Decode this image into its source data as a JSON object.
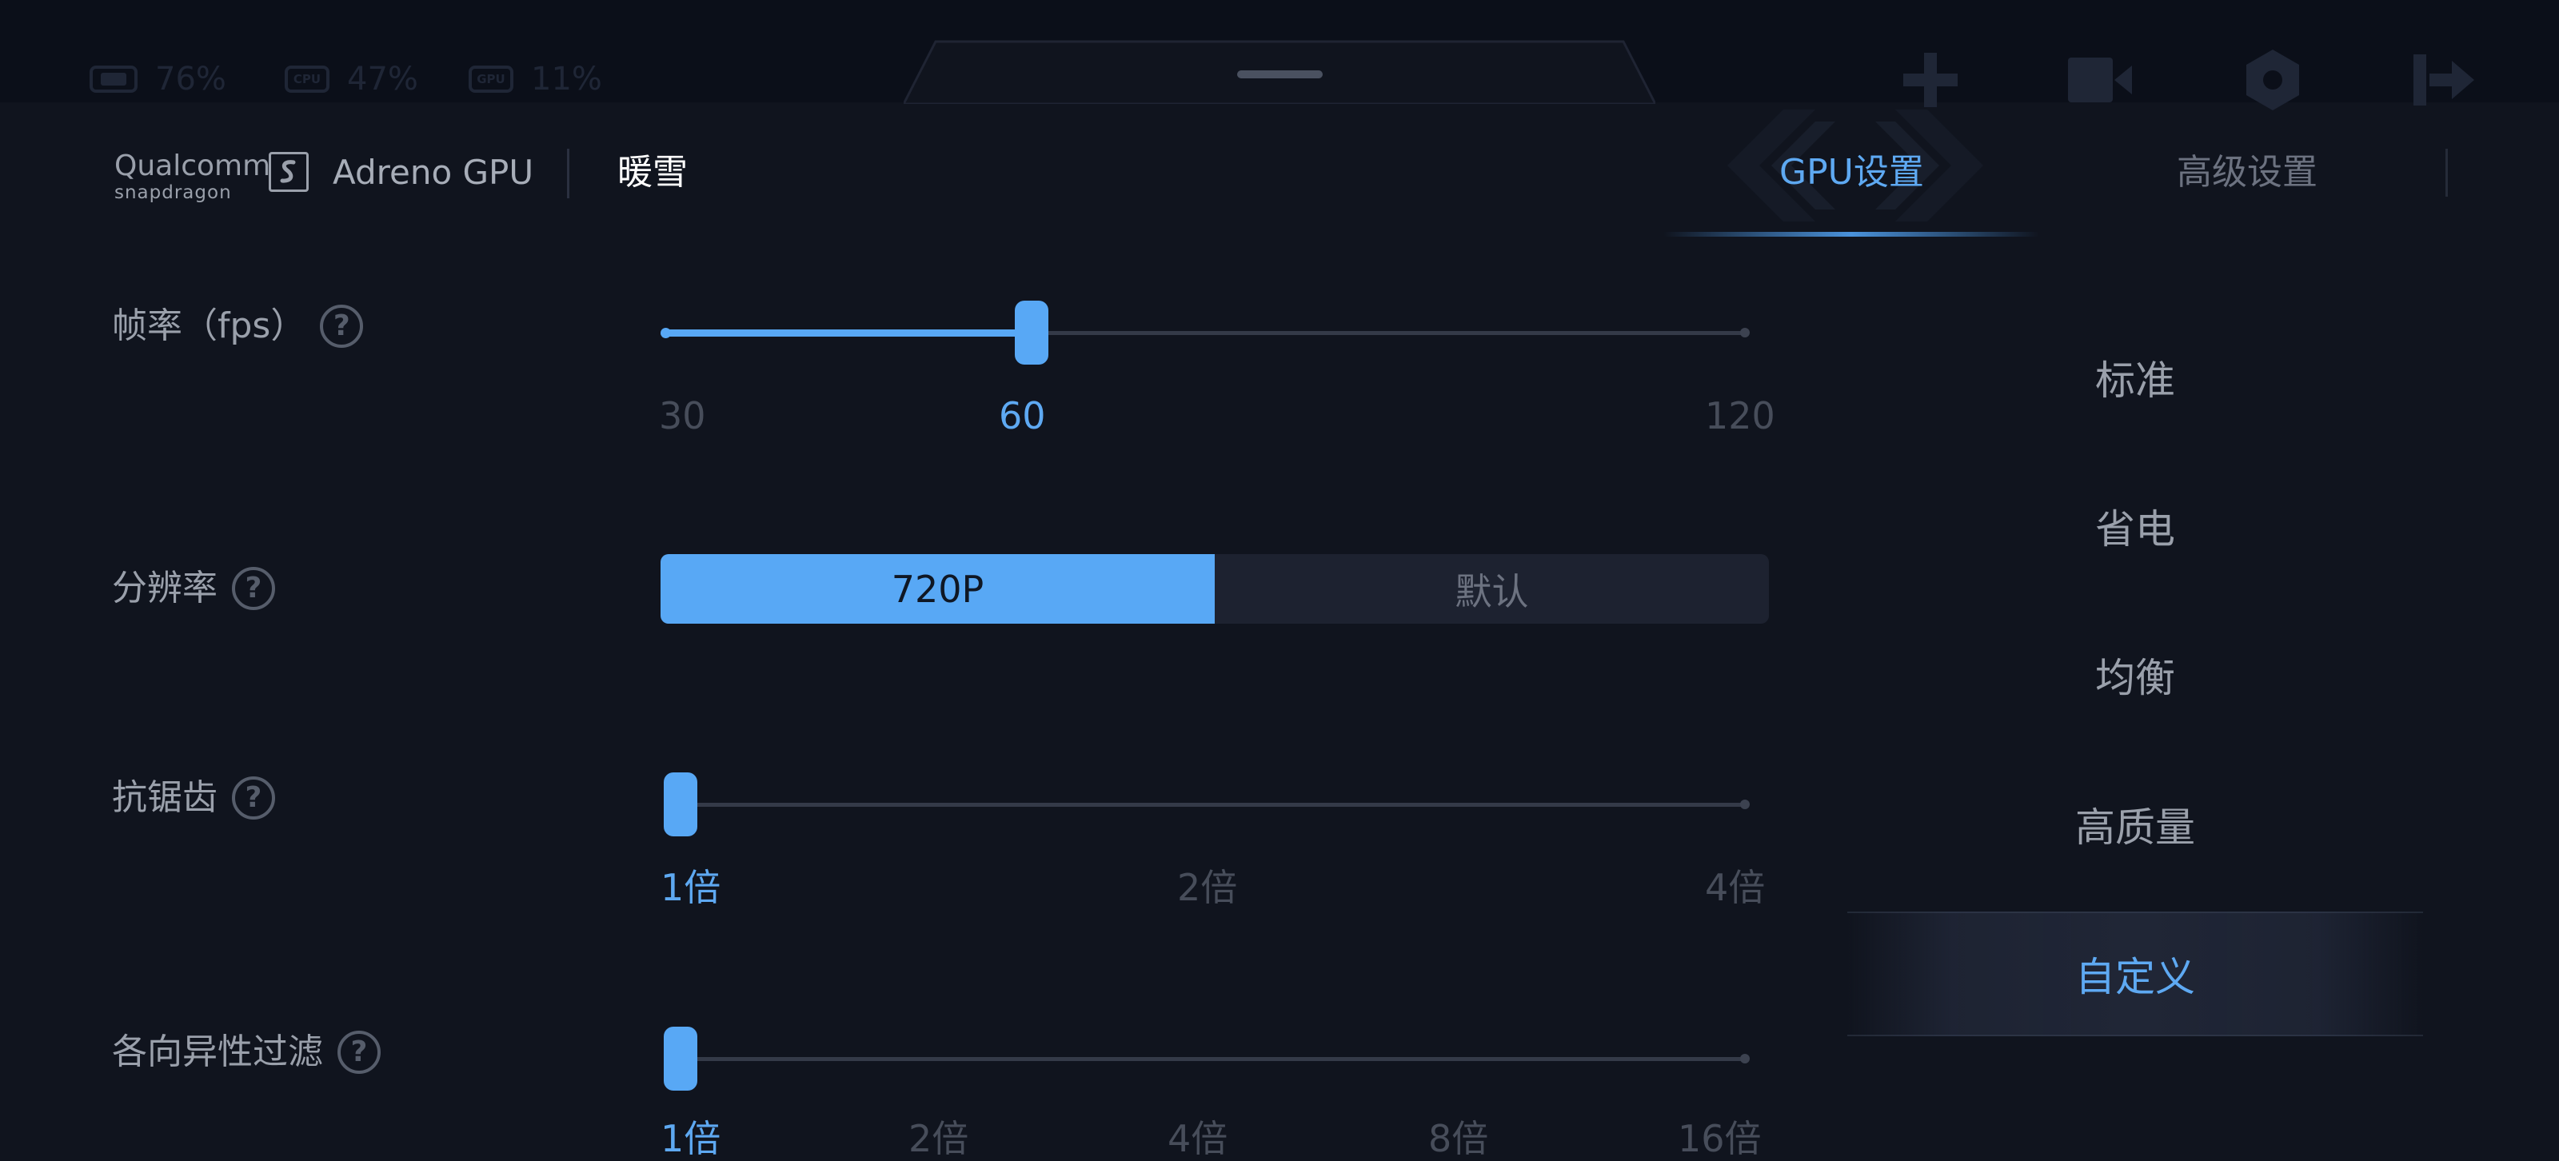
{
  "status": {
    "battery_value": "76%",
    "cpu_chip": "CPU",
    "cpu_value": "47%",
    "gpu_chip": "GPU",
    "gpu_value": "11%"
  },
  "top_icons": [
    "plus-icon",
    "video-icon",
    "settings-icon",
    "exit-icon"
  ],
  "header": {
    "brand_title": "Qualcomm",
    "brand_subtitle": "snapdragon",
    "product": "Adreno GPU",
    "game": "暖雪"
  },
  "tabs": [
    {
      "label": "GPU设置",
      "active": true
    },
    {
      "label": "高级设置",
      "active": false
    }
  ],
  "settings": {
    "fps": {
      "label": "帧率（fps）",
      "ticks": [
        "30",
        "60",
        "120"
      ],
      "selected": "60",
      "value_fraction": 0.33
    },
    "resolution": {
      "label": "分辨率",
      "options": [
        "720P",
        "默认"
      ],
      "selected": "720P"
    },
    "antialias": {
      "label": "抗锯齿",
      "ticks": [
        "1倍",
        "2倍",
        "4倍"
      ],
      "selected": "1倍",
      "value_fraction": 0
    },
    "anisotropic": {
      "label": "各向异性过滤",
      "ticks": [
        "1倍",
        "2倍",
        "4倍",
        "8倍",
        "16倍"
      ],
      "selected": "1倍",
      "value_fraction": 0
    }
  },
  "presets": [
    {
      "label": "标准",
      "selected": false
    },
    {
      "label": "省电",
      "selected": false
    },
    {
      "label": "均衡",
      "selected": false
    },
    {
      "label": "高质量",
      "selected": false
    },
    {
      "label": "自定义",
      "selected": true
    }
  ],
  "colors": {
    "accent": "#58a8f5",
    "background": "#10141e",
    "top_strip": "#0b0f19"
  }
}
